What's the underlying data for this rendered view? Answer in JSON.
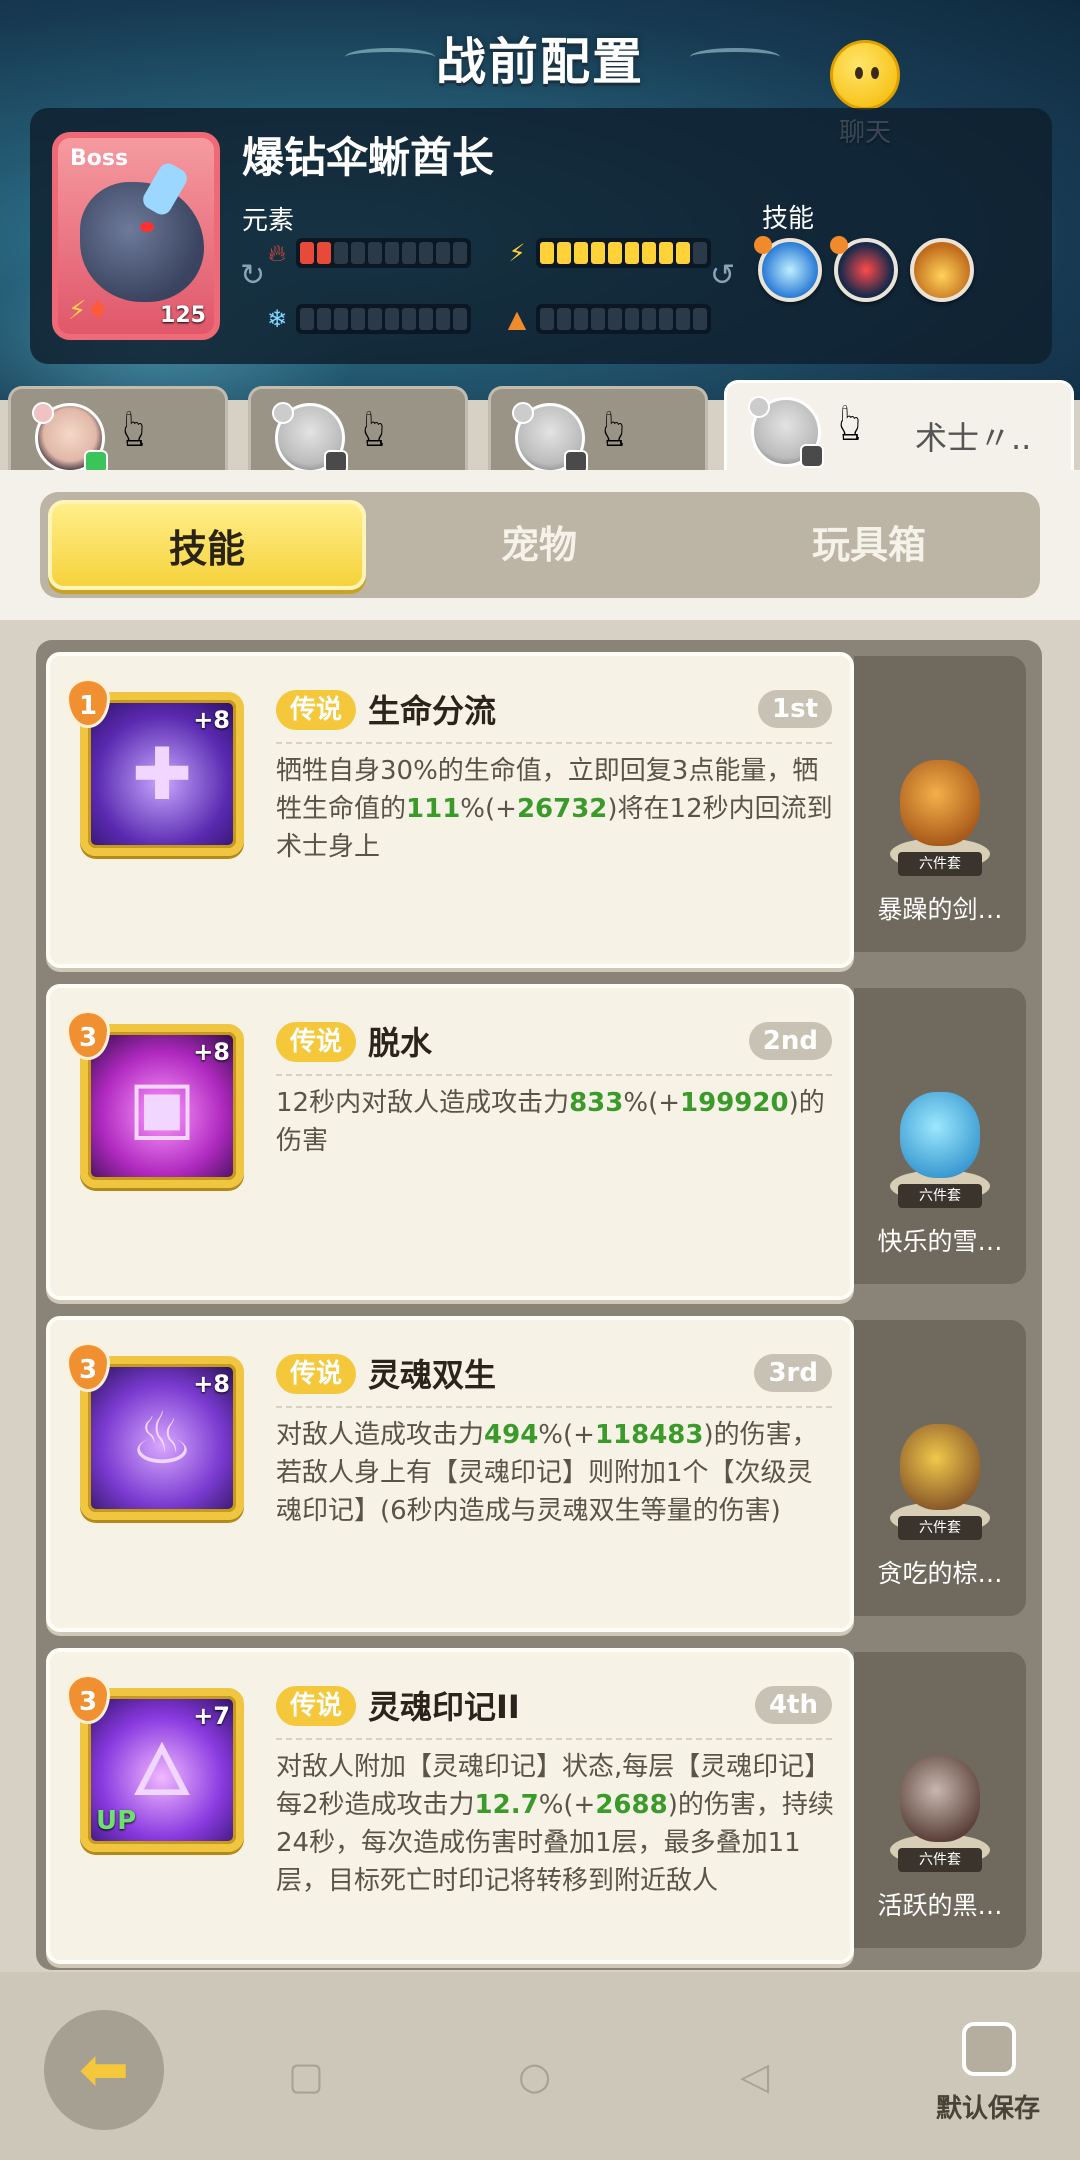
{
  "header": {
    "title": "战前配置",
    "chat_label": "聊天"
  },
  "boss": {
    "tag": "Boss",
    "level": "125",
    "name": "爆钻伞蜥酋长",
    "elements_label": "元素",
    "skills_label": "技能",
    "elements": [
      {
        "icon": "fire-icon",
        "filled": 2,
        "total": 10,
        "color": "#e84a3a"
      },
      {
        "icon": "lightning-icon",
        "filled": 9,
        "total": 10,
        "color": "#ffd23a"
      },
      {
        "icon": "ice-icon",
        "filled": 0,
        "total": 10,
        "color": "#2a3a48"
      },
      {
        "icon": "earth-icon",
        "filled": 0,
        "total": 10,
        "color": "#2a3a48"
      }
    ]
  },
  "characters": [
    {
      "name": ""
    },
    {
      "name": ""
    },
    {
      "name": ""
    },
    {
      "name": "术士〃.."
    }
  ],
  "tabs": {
    "skills": "技能",
    "pets": "宠物",
    "toybox": "玩具箱"
  },
  "skills": [
    {
      "num": "1",
      "plus": "+8",
      "up": "",
      "tier": "传说",
      "title": "生命分流",
      "rank": "1st",
      "desc_parts": [
        "牺牲自身30%的生命值，立即回复3点能量，牺牲生命值的",
        "111",
        "%(+",
        "26732",
        ")将在12秒内回流到术士身上"
      ],
      "pet_name": "暴躁的剑…",
      "pet_set": "六件套"
    },
    {
      "num": "3",
      "plus": "+8",
      "up": "",
      "tier": "传说",
      "title": "脱水",
      "rank": "2nd",
      "desc_parts": [
        "12秒内对敌人造成攻击力",
        "833",
        "%(+",
        "199920",
        ")的伤害"
      ],
      "pet_name": "快乐的雪…",
      "pet_set": "六件套"
    },
    {
      "num": "3",
      "plus": "+8",
      "up": "",
      "tier": "传说",
      "title": "灵魂双生",
      "rank": "3rd",
      "desc_parts": [
        "对敌人造成攻击力",
        "494",
        "%(+",
        "118483",
        ")的伤害，若敌人身上有【灵魂印记】则附加1个【次级灵魂印记】(6秒内造成与灵魂双生等量的伤害)"
      ],
      "pet_name": "贪吃的棕…",
      "pet_set": "六件套"
    },
    {
      "num": "3",
      "plus": "+7",
      "up": "UP",
      "tier": "传说",
      "title": "灵魂印记II",
      "rank": "4th",
      "desc_parts": [
        "对敌人附加【灵魂印记】状态,每层【灵魂印记】每2秒造成攻击力",
        "12.7",
        "%(+",
        "2688",
        ")的伤害，持续24秒，每次造成伤害时叠加1层，最多叠加11层，目标死亡时印记将转移到附近敌人"
      ],
      "pet_name": "活跃的黑…",
      "pet_set": "六件套"
    }
  ],
  "bottom": {
    "save_label": "默认保存"
  }
}
